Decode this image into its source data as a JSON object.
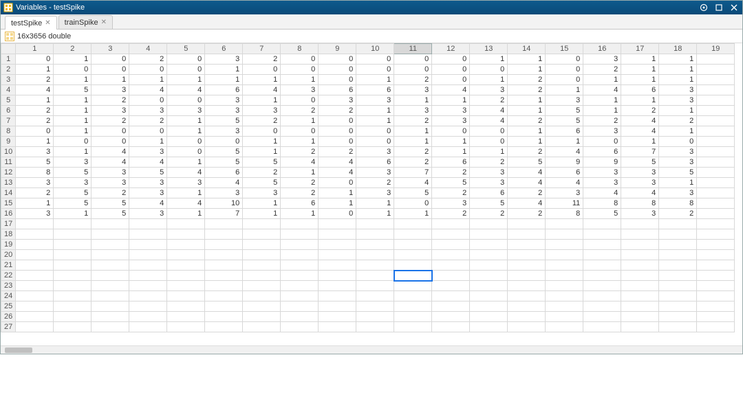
{
  "window": {
    "title": "Variables - testSpike"
  },
  "tabs": [
    {
      "label": "testSpike",
      "active": true
    },
    {
      "label": "trainSpike",
      "active": false
    }
  ],
  "type_text": "16x3656 double",
  "selected_cell": {
    "row": 22,
    "col": 11
  },
  "selected_col": 11,
  "column_count": 19,
  "row_count": 27,
  "chart_data": {
    "type": "table",
    "title": "testSpike (16x3656 double, showing cols 1–19)",
    "columns": [
      "1",
      "2",
      "3",
      "4",
      "5",
      "6",
      "7",
      "8",
      "9",
      "10",
      "11",
      "12",
      "13",
      "14",
      "15",
      "16",
      "17",
      "18"
    ],
    "rows": [
      [
        0,
        1,
        0,
        2,
        0,
        3,
        2,
        0,
        0,
        0,
        0,
        0,
        1,
        1,
        0,
        3,
        1,
        1
      ],
      [
        1,
        0,
        0,
        0,
        0,
        1,
        0,
        0,
        0,
        0,
        0,
        0,
        0,
        1,
        0,
        2,
        1,
        1
      ],
      [
        2,
        1,
        1,
        1,
        1,
        1,
        1,
        1,
        0,
        1,
        2,
        0,
        1,
        2,
        0,
        1,
        1,
        1
      ],
      [
        4,
        5,
        3,
        4,
        4,
        6,
        4,
        3,
        6,
        6,
        3,
        4,
        3,
        2,
        1,
        4,
        6,
        3
      ],
      [
        1,
        1,
        2,
        0,
        0,
        3,
        1,
        0,
        3,
        3,
        1,
        1,
        2,
        1,
        3,
        1,
        1,
        3
      ],
      [
        2,
        1,
        3,
        3,
        3,
        3,
        3,
        2,
        2,
        1,
        3,
        3,
        4,
        1,
        5,
        1,
        2,
        1
      ],
      [
        2,
        1,
        2,
        2,
        1,
        5,
        2,
        1,
        0,
        1,
        2,
        3,
        4,
        2,
        5,
        2,
        4,
        2
      ],
      [
        0,
        1,
        0,
        0,
        1,
        3,
        0,
        0,
        0,
        0,
        1,
        0,
        0,
        1,
        6,
        3,
        4,
        1
      ],
      [
        1,
        0,
        0,
        1,
        0,
        0,
        1,
        1,
        0,
        0,
        1,
        1,
        0,
        1,
        1,
        0,
        1,
        0
      ],
      [
        3,
        1,
        4,
        3,
        0,
        5,
        1,
        2,
        2,
        3,
        2,
        1,
        1,
        2,
        4,
        6,
        7,
        3
      ],
      [
        5,
        3,
        4,
        4,
        1,
        5,
        5,
        4,
        4,
        6,
        2,
        6,
        2,
        5,
        9,
        9,
        5,
        3
      ],
      [
        8,
        5,
        3,
        5,
        4,
        6,
        2,
        1,
        4,
        3,
        7,
        2,
        3,
        4,
        6,
        3,
        3,
        5
      ],
      [
        3,
        3,
        3,
        3,
        3,
        4,
        5,
        2,
        0,
        2,
        4,
        5,
        3,
        4,
        4,
        3,
        3,
        1
      ],
      [
        2,
        5,
        2,
        3,
        1,
        3,
        3,
        2,
        1,
        3,
        5,
        2,
        6,
        2,
        3,
        4,
        4,
        3
      ],
      [
        1,
        5,
        5,
        4,
        4,
        10,
        1,
        6,
        1,
        1,
        0,
        3,
        5,
        4,
        11,
        8,
        8,
        8
      ],
      [
        3,
        1,
        5,
        3,
        1,
        7,
        1,
        1,
        0,
        1,
        1,
        2,
        2,
        2,
        8,
        5,
        3,
        2
      ]
    ]
  }
}
